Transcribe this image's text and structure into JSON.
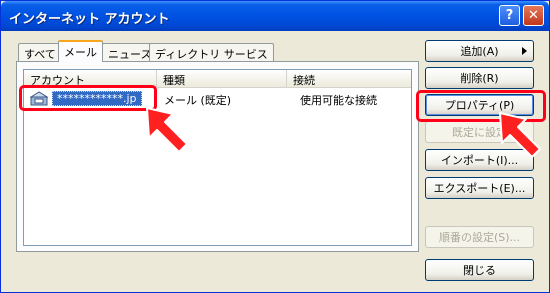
{
  "window": {
    "title": "インターネット アカウント",
    "help_glyph": "?",
    "close_glyph": "✕"
  },
  "tabs": [
    {
      "label": "すべて"
    },
    {
      "label": "メール"
    },
    {
      "label": "ニュース"
    },
    {
      "label": "ディレクトリ サービス"
    }
  ],
  "list": {
    "columns": [
      "アカウント",
      "種類",
      "接続"
    ],
    "rows": [
      {
        "account": "************.jp",
        "type": "メール (既定)",
        "connection": "使用可能な接続"
      }
    ]
  },
  "buttons": {
    "add": "追加(A)",
    "remove": "削除(R)",
    "properties": "プロパティ(P)",
    "set_default": "既定に設定",
    "import": "インポート(I)...",
    "export": "エクスポート(E)...",
    "set_order": "順番の設定(S)...",
    "close": "閉じる"
  },
  "colors": {
    "highlight": "#ff0018",
    "pointer_fill": "#ff2020",
    "selection": "#316ac5"
  }
}
